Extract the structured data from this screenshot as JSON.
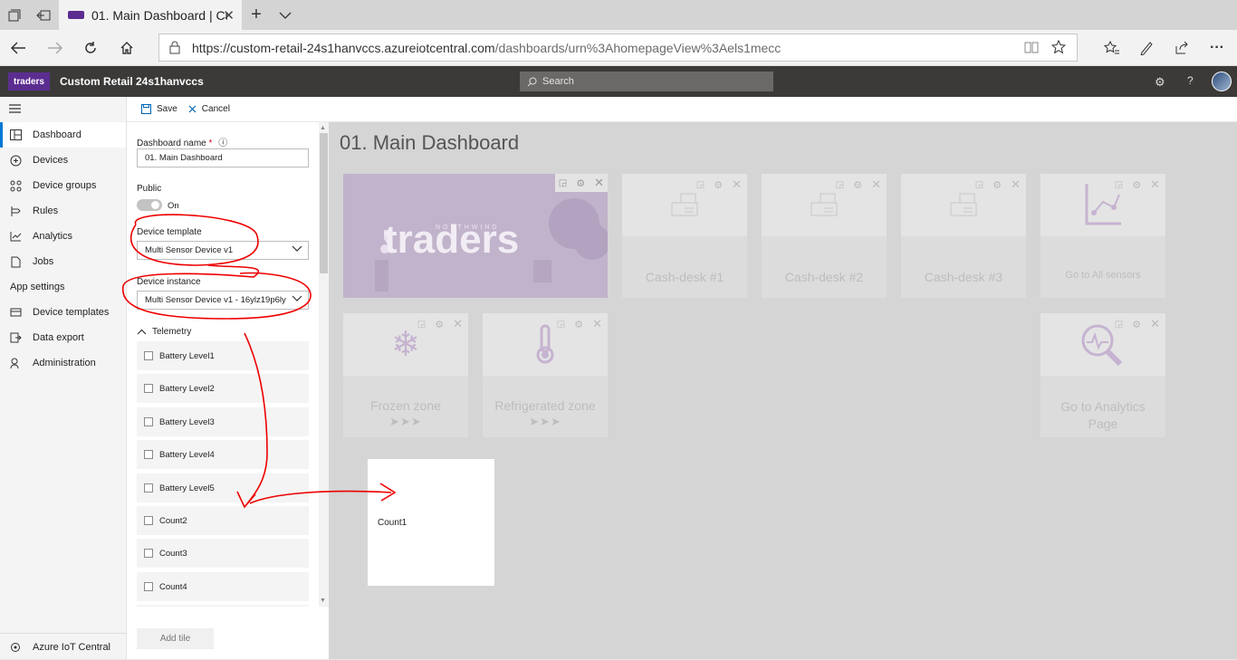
{
  "browser": {
    "tab_title": "01. Main Dashboard | Cu",
    "url_host": "https://custom-retail-24s1hanvccs.azureiotcentral.com",
    "url_path": "/dashboards/urn%3AhomepageView%3Aels1mecc"
  },
  "app": {
    "logo_text": "traders",
    "name": "Custom Retail 24s1hanvccs",
    "search_placeholder": "Search",
    "brand_color": "#5c2d91"
  },
  "nav": {
    "items": [
      {
        "label": "Dashboard",
        "icon": "dashboard-icon",
        "active": true
      },
      {
        "label": "Devices",
        "icon": "devices-icon"
      },
      {
        "label": "Device groups",
        "icon": "device-groups-icon"
      },
      {
        "label": "Rules",
        "icon": "rules-icon"
      },
      {
        "label": "Analytics",
        "icon": "analytics-icon"
      },
      {
        "label": "Jobs",
        "icon": "jobs-icon"
      }
    ],
    "settings_header": "App settings",
    "settings_items": [
      {
        "label": "Device templates",
        "icon": "device-templates-icon"
      },
      {
        "label": "Data export",
        "icon": "data-export-icon"
      },
      {
        "label": "Administration",
        "icon": "administration-icon"
      }
    ],
    "footer": "Azure IoT Central"
  },
  "toolbar": {
    "save": "Save",
    "cancel": "Cancel"
  },
  "panel": {
    "dashboard_name_label": "Dashboard name",
    "dashboard_name_required": "*",
    "dashboard_name_value": "01. Main Dashboard",
    "public_label": "Public",
    "public_state": "On",
    "device_template_label": "Device template",
    "device_template_value": "Multi Sensor Device v1",
    "device_instance_label": "Device instance",
    "device_instance_value": "Multi Sensor Device v1 - 16ylz19p6ly",
    "telemetry_header": "Telemetry",
    "telemetry": [
      "Battery Level1",
      "Battery Level2",
      "Battery Level3",
      "Battery Level4",
      "Battery Level5",
      "Count2",
      "Count3",
      "Count4"
    ],
    "add_tile": "Add tile"
  },
  "dashboard": {
    "title": "01. Main Dashboard",
    "hero": {
      "brand_small": "NORTHWIND",
      "brand_word": "traders"
    },
    "tiles": [
      {
        "title": "Cash-desk #1",
        "icon": "cash-register-icon"
      },
      {
        "title": "Cash-desk #2",
        "icon": "cash-register-icon"
      },
      {
        "title": "Cash-desk #3",
        "icon": "cash-register-icon"
      },
      {
        "title": "Go to All sensors",
        "icon": "sensor-chart-icon"
      },
      {
        "title": "Frozen zone",
        "icon": "snowflake-icon",
        "arrows": "➤➤➤"
      },
      {
        "title": "Refrigerated zone",
        "icon": "thermometer-icon",
        "arrows": "➤➤➤"
      },
      {
        "title": "Go to Analytics Page",
        "icon": "analytics-search-icon"
      }
    ],
    "new_tile_label": "Count1"
  }
}
